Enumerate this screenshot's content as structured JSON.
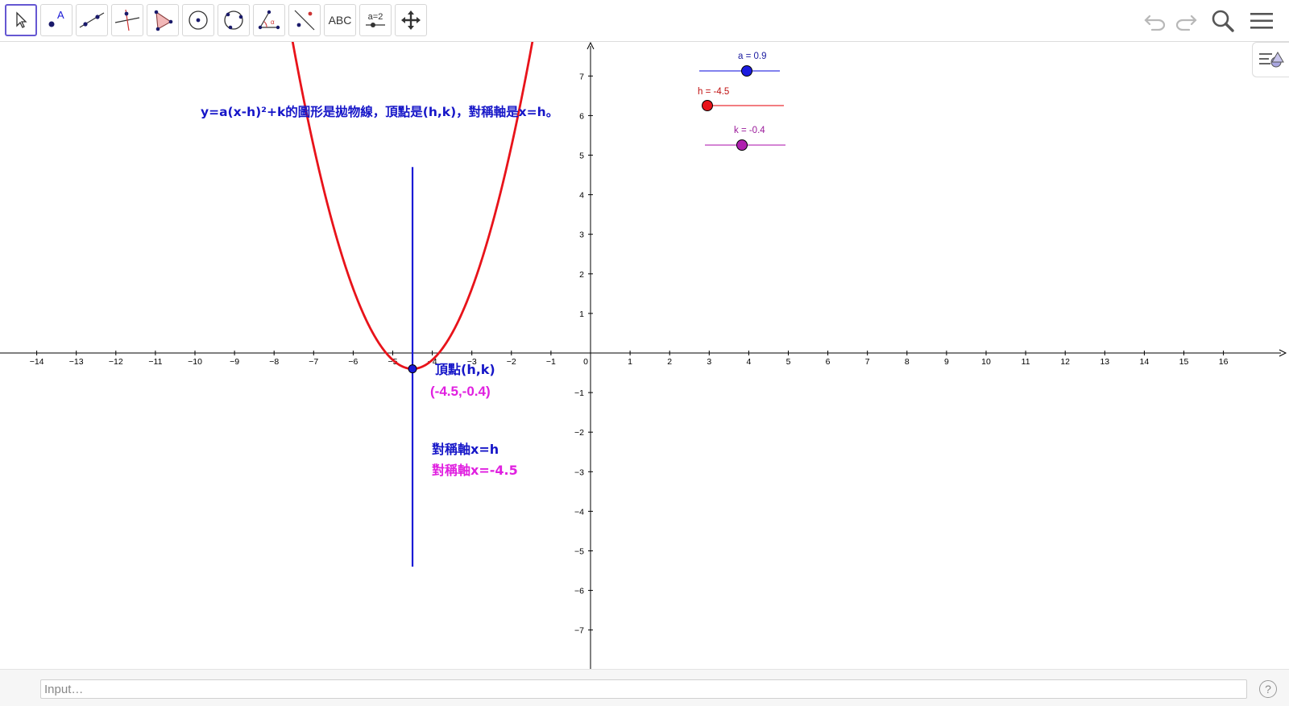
{
  "toolbar": {
    "tools": [
      {
        "id": "move",
        "icon": "cursor-arrow-icon"
      },
      {
        "id": "point",
        "icon": "point-icon",
        "label": "A"
      },
      {
        "id": "line",
        "icon": "line-through-points-icon"
      },
      {
        "id": "perpendicular",
        "icon": "perpendicular-line-icon"
      },
      {
        "id": "polygon",
        "icon": "polygon-icon"
      },
      {
        "id": "circle-center",
        "icon": "circle-center-point-icon"
      },
      {
        "id": "circle-3pts",
        "icon": "circle-three-points-icon"
      },
      {
        "id": "angle",
        "icon": "angle-icon",
        "label": "α"
      },
      {
        "id": "reflect",
        "icon": "reflect-about-line-icon"
      },
      {
        "id": "text",
        "icon": "text-icon",
        "label": "ABC"
      },
      {
        "id": "slider",
        "icon": "slider-icon",
        "label": "a=2"
      },
      {
        "id": "move-graphics",
        "icon": "move-graphics-view-icon"
      }
    ],
    "right": [
      "undo-icon",
      "redo-icon",
      "search-icon",
      "menu-icon"
    ]
  },
  "graphics": {
    "title_text": "y=a(x-h)²+k的圖形是拋物線，頂點是(h,k)，對稱軸是x=h。",
    "vertex_label": "頂點(h,k)",
    "vertex_value": "(-4.5,-0.4)",
    "axis_label": "對稱軸x=h",
    "axis_value": "對稱軸x=-4.5",
    "x_ticks": [
      "−14",
      "−13",
      "−12",
      "−11",
      "−10",
      "−9",
      "−8",
      "−7",
      "−6",
      "−5",
      "−4",
      "−3",
      "−2",
      "−1",
      "0",
      "1",
      "2",
      "3",
      "4",
      "5",
      "6",
      "7",
      "8",
      "9",
      "10",
      "11",
      "12",
      "13",
      "14",
      "15",
      "16"
    ],
    "y_ticks": [
      "7",
      "6",
      "5",
      "4",
      "3",
      "2",
      "1",
      "−1",
      "−2",
      "−3",
      "−4",
      "−5",
      "−6",
      "−7"
    ],
    "colors": {
      "parabola": "#e8131a",
      "symmetry_axis": "#1a1ad6",
      "blue_text": "#1616c8",
      "magenta_text": "#e020e0",
      "slider_a": "#1c1ce0",
      "slider_h": "#e8131a",
      "slider_k": "#b020b0"
    }
  },
  "sliders": [
    {
      "name": "a",
      "label": "a = 0.9",
      "value": 0.9,
      "min": -5,
      "max": 5
    },
    {
      "name": "h",
      "label": "h = -4.5",
      "value": -4.5,
      "min": -5,
      "max": 5
    },
    {
      "name": "k",
      "label": "k = -0.4",
      "value": -0.4,
      "min": -5,
      "max": 5
    }
  ],
  "parabola": {
    "a": 0.9,
    "h": -4.5,
    "k": -0.4
  },
  "inputbar": {
    "placeholder": "Input…",
    "help": "?"
  }
}
